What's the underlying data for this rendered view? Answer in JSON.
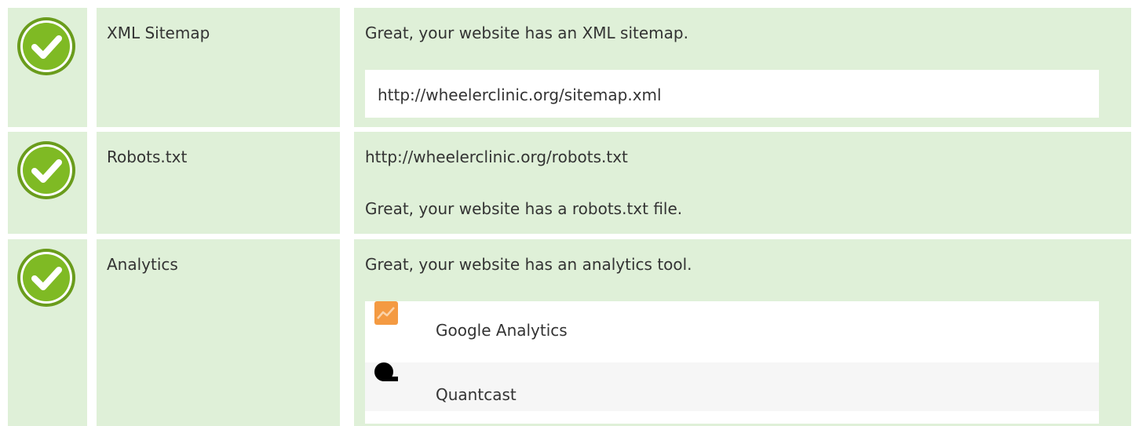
{
  "rows": [
    {
      "label": "XML Sitemap",
      "status_icon": "checkmark-icon",
      "message": "Great, your website has an XML sitemap.",
      "url": "http://wheelerclinic.org/sitemap.xml"
    },
    {
      "label": "Robots.txt",
      "status_icon": "checkmark-icon",
      "url": "http://wheelerclinic.org/robots.txt",
      "message": "Great, your website has a robots.txt file."
    },
    {
      "label": "Analytics",
      "status_icon": "checkmark-icon",
      "message": "Great, your website has an analytics tool.",
      "tools": [
        {
          "name": "Google Analytics",
          "icon": "google-analytics-icon"
        },
        {
          "name": "Quantcast",
          "icon": "quantcast-icon"
        }
      ]
    }
  ],
  "colors": {
    "row_background": "#dff0d8",
    "check_green": "#7fba24",
    "text": "#333333"
  }
}
